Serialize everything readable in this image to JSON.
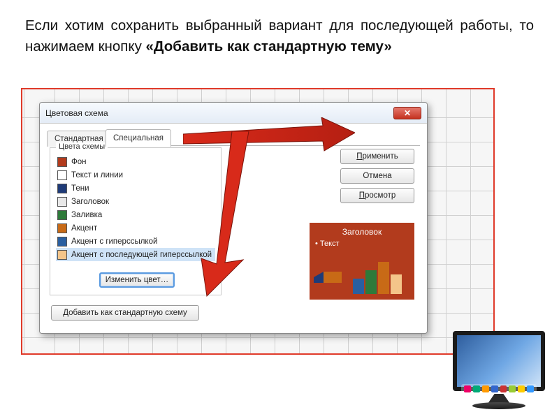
{
  "headline_plain": "Если хотим сохранить выбранный вариант для последующей работы, то нажимаем кнопку ",
  "headline_bold": "«Добавить как стандартную тему»",
  "dialog": {
    "title": "Цветовая схема",
    "tabs": {
      "standard": "Стандартная",
      "special": "Специальная"
    },
    "group_label": "Цвета схемы",
    "items": [
      {
        "label": "Фон",
        "color": "#b23b1d"
      },
      {
        "label": "Текст и линии",
        "color": "#ffffff"
      },
      {
        "label": "Тени",
        "color": "#1f3b78"
      },
      {
        "label": "Заголовок",
        "color": "#e8e8e8"
      },
      {
        "label": "Заливка",
        "color": "#2e7a3a"
      },
      {
        "label": "Акцент",
        "color": "#c86a16"
      },
      {
        "label": "Акцент с гиперссылкой",
        "color": "#2a5fa0"
      },
      {
        "label": "Акцент с последующей гиперссылкой",
        "color": "#f4c58a"
      }
    ],
    "buttons": {
      "change_color": "Изменить цвет…",
      "add_theme": "Добавить как стандартную схему",
      "apply": "Применить",
      "cancel": "Отмена",
      "preview": "Просмотр"
    },
    "preview": {
      "title": "Заголовок",
      "bullet": "Текст"
    }
  },
  "colors": {
    "frame": "#e03a2a",
    "arrow": "#d82a1a",
    "dialog_bg": "#ffffff"
  }
}
